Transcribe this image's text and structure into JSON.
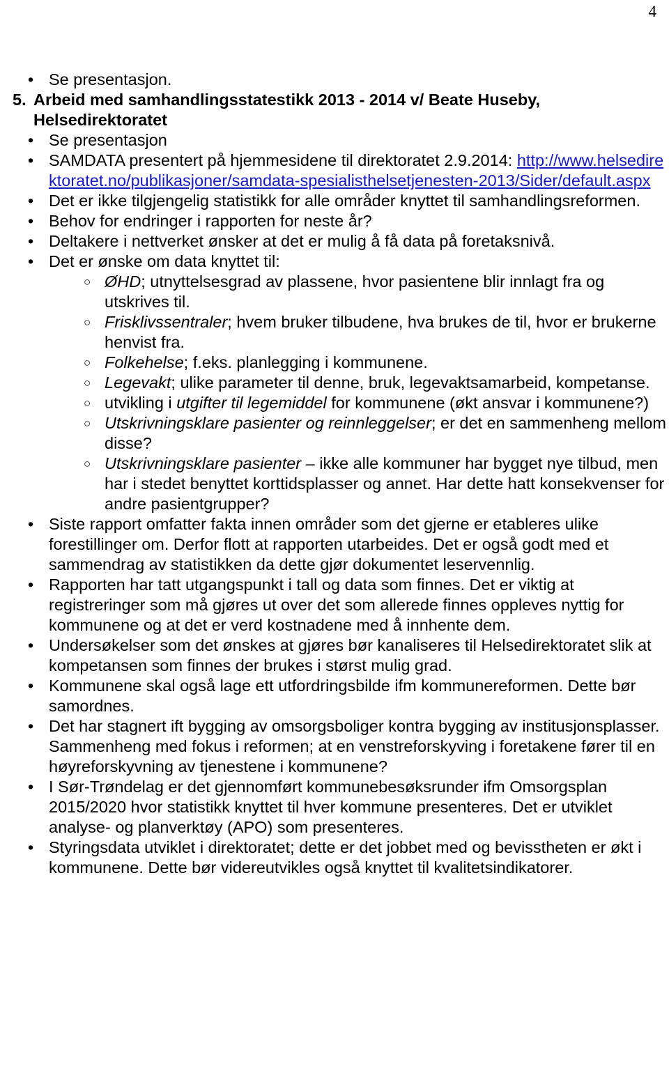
{
  "page": {
    "number": "4"
  },
  "lead": {
    "bullet_glyph": "•",
    "items": [
      "Se presentasjon."
    ]
  },
  "section": {
    "number": "5.",
    "title_line1": "Arbeid med samhandlingsstatestikk 2013 - 2014 v/ Beate Huseby,",
    "title_line2": "Helsedirektoratet",
    "bullet_glyph": "•",
    "sub_bullet_glyph": "○",
    "items": [
      {
        "id": "se-presentasjon",
        "text": "Se presentasjon"
      },
      {
        "id": "samdata-link",
        "text": "SAMDATA presentert på hjemmesidene til direktoratet 2.9.2014:",
        "link_text": "http://www.helsedirektoratet.no/publikasjoner/samdata-spesialisthelsetjenesten-2013/Sider/default.aspx",
        "link_color": "#1a1ab8"
      },
      {
        "id": "ikke-tilgjengelig",
        "text": "Det er ikke tilgjengelig statistikk for alle områder knyttet til samhandlingsreformen."
      },
      {
        "id": "behov-endringer",
        "text": "Behov for endringer i rapporten for neste år?"
      },
      {
        "id": "deltakere-nettverk",
        "text": "Deltakere i nettverket ønsker at det er mulig å få data på foretaksnivå."
      },
      {
        "id": "onske-data",
        "text": "Det er ønske om data knyttet til:",
        "subitems": [
          {
            "id": "ohd",
            "italic_lead": "ØHD",
            "rest": "; utnyttelsesgrad av plassene, hvor pasientene blir innlagt fra og utskrives til."
          },
          {
            "id": "frisklivssentraler",
            "italic_lead": "Frisklivssentraler",
            "rest": "; hvem bruker tilbudene, hva brukes de til, hvor er brukerne henvist fra."
          },
          {
            "id": "folkehelse",
            "italic_lead": "Folkehelse",
            "rest": "; f.eks. planlegging i kommunene."
          },
          {
            "id": "legevakt",
            "italic_lead": "Legevakt",
            "rest": "; ulike parameter til denne, bruk, legevaktsamarbeid, kompetanse."
          },
          {
            "id": "utgifter-legemiddel",
            "pre": "utvikling i ",
            "italic_mid": "utgifter til legemiddel",
            "rest": " for kommunene (økt ansvar i kommunene?)"
          },
          {
            "id": "utskrivningsklare-reinnleggelser",
            "italic_lead": "Utskrivningsklare pasienter og reinnleggelser",
            "rest": "; er det en sammenheng mellom disse?"
          },
          {
            "id": "utskrivningsklare-pasienter",
            "italic_lead": "Utskrivningsklare pasienter",
            "rest": " – ikke alle kommuner har bygget nye tilbud, men har i stedet benyttet korttidsplasser og annet. Har dette hatt konsekvenser for andre pasientgrupper?"
          }
        ]
      },
      {
        "id": "siste-rapport",
        "text": "Siste rapport omfatter fakta innen områder som det gjerne er etableres ulike forestillinger om. Derfor flott at rapporten utarbeides. Det er også godt med et sammendrag av statistikken da dette gjør dokumentet leservennlig."
      },
      {
        "id": "rapporten-utgangspunkt",
        "text": "Rapporten har tatt utgangspunkt i tall og data som finnes. Det er viktig at registreringer som må gjøres ut over det som allerede finnes oppleves nyttig for kommunene og at det er verd kostnadene med å innhente dem."
      },
      {
        "id": "undersokelser",
        "text": "Undersøkelser som det ønskes at gjøres bør kanaliseres til Helsedirektoratet slik at kompetansen som finnes der brukes i størst mulig grad."
      },
      {
        "id": "kommunene-utfordringsbilde",
        "text": "Kommunene skal også lage ett utfordringsbilde ifm kommunereformen. Dette bør samordnes."
      },
      {
        "id": "stagnert-omsorgsboliger",
        "text": "Det har stagnert ift bygging av omsorgsboliger kontra bygging av institusjonsplasser. Sammenheng med fokus i reformen; at en venstreforskyving i foretakene fører til en høyreforskyvning av tjenestene i kommunene?"
      },
      {
        "id": "sor-trondelag",
        "text": "I Sør-Trøndelag er det gjennomført kommunebesøksrunder ifm Omsorgsplan 2015/2020 hvor statistikk knyttet til hver kommune presenteres. Det er utviklet analyse- og planverktøy (APO) som presenteres."
      },
      {
        "id": "styringsdata",
        "text": "Styringsdata utviklet i direktoratet; dette er det jobbet med og bevisstheten er økt i kommunene. Dette bør videreutvikles også knyttet til kvalitetsindikatorer."
      }
    ]
  }
}
